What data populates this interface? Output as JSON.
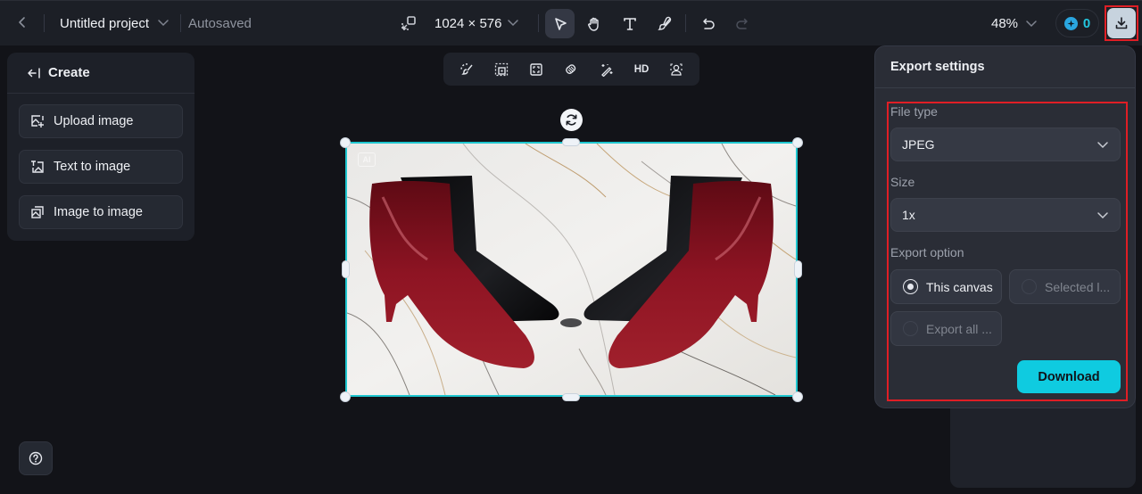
{
  "header": {
    "project_title": "Untitled project",
    "autosave_status": "Autosaved",
    "canvas_size": "1024 × 576",
    "zoom_level": "48%",
    "credits": "0",
    "tools": [
      {
        "name": "select",
        "icon": "pointer-icon",
        "active": true
      },
      {
        "name": "hand",
        "icon": "hand-icon",
        "active": false
      },
      {
        "name": "text",
        "icon": "text-icon",
        "active": false
      },
      {
        "name": "brush",
        "icon": "brush-icon",
        "active": false
      }
    ]
  },
  "create_panel": {
    "title": "Create",
    "items": [
      {
        "label": "Upload image",
        "icon": "upload-image-icon"
      },
      {
        "label": "Text to image",
        "icon": "text-to-image-icon"
      },
      {
        "label": "Image to image",
        "icon": "image-to-image-icon"
      }
    ]
  },
  "floating_toolbar": {
    "items": [
      {
        "icon": "remove-background-icon"
      },
      {
        "icon": "expand-image-icon"
      },
      {
        "icon": "crop-icon"
      },
      {
        "icon": "eraser-icon"
      },
      {
        "icon": "magic-wand-icon"
      },
      {
        "label": "HD",
        "icon": "upscale-hd-icon"
      },
      {
        "icon": "person-retouch-icon"
      }
    ]
  },
  "canvas": {
    "ai_badge": "AI",
    "image_description": "Two pairs of glossy red and black pointed-toe high-heel ankle boots mirrored on a white marble background"
  },
  "export_panel": {
    "title": "Export settings",
    "file_type_label": "File type",
    "file_type_value": "JPEG",
    "size_label": "Size",
    "size_value": "1x",
    "export_option_label": "Export option",
    "options": [
      {
        "label": "This canvas",
        "checked": true
      },
      {
        "label": "Selected l...",
        "checked": false
      },
      {
        "label": "Export all ...",
        "checked": false
      }
    ],
    "download_label": "Download"
  },
  "colors": {
    "accent": "#0fcbe0",
    "selection": "#1fc6cf",
    "highlight": "#e01e25",
    "background": "#121318",
    "panel": "#2a2d36"
  }
}
